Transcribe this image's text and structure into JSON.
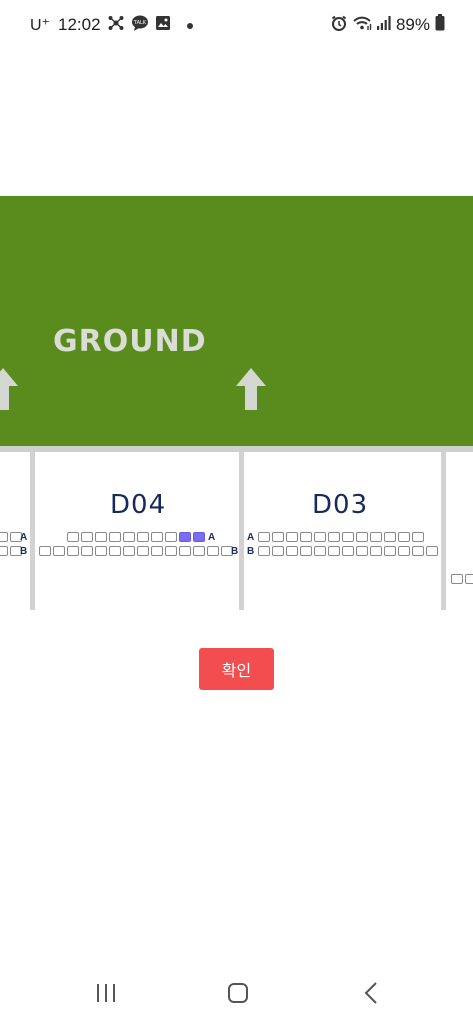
{
  "status_bar": {
    "carrier": "U⁺",
    "time": "12:02",
    "battery": "89%",
    "icons_left": [
      "network-icon",
      "kakaotalk-icon",
      "gallery-icon",
      "dot-icon"
    ],
    "icons_right": [
      "alarm-icon",
      "wifi-icon",
      "signal-icon",
      "battery-icon"
    ]
  },
  "stadium": {
    "ground_label": "GROUND",
    "ground_color": "#5a8b1d",
    "sections": [
      {
        "id": "left-partial",
        "rows": [
          {
            "letter": "A",
            "seats": 2,
            "selected": []
          },
          {
            "letter": "B",
            "seats": 2,
            "selected": []
          }
        ]
      },
      {
        "id": "D04",
        "title": "D04",
        "rows": [
          {
            "letter": "A",
            "seats": 10,
            "selected": [
              8,
              9
            ]
          },
          {
            "letter": "B",
            "seats": 14,
            "selected": []
          }
        ]
      },
      {
        "id": "D03",
        "title": "D03",
        "rows": [
          {
            "letter": "A",
            "seats": 12,
            "selected": []
          },
          {
            "letter": "B",
            "seats": 13,
            "selected": []
          }
        ]
      },
      {
        "id": "right-partial",
        "rows": [
          {
            "letter": "",
            "seats": 2,
            "selected": []
          }
        ]
      }
    ],
    "selected_color": "#7b6cf0"
  },
  "confirm_button": {
    "label": "확인",
    "color": "#f24e50"
  },
  "nav_bar": {
    "items": [
      "recent-apps-icon",
      "home-icon",
      "back-icon"
    ]
  }
}
